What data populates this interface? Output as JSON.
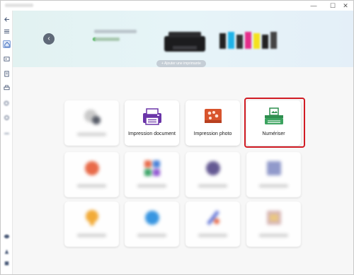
{
  "window": {
    "controls": {
      "minimize": "—",
      "maximize": "☐",
      "close": "✕"
    }
  },
  "sidebar": {
    "items": [
      {
        "icon": "back-arrow-icon"
      },
      {
        "icon": "menu-icon"
      },
      {
        "icon": "home-icon",
        "active": true
      },
      {
        "icon": "photo-icon"
      },
      {
        "icon": "document-icon"
      },
      {
        "icon": "printer-icon"
      },
      {
        "icon": "search-icon"
      },
      {
        "icon": "gear-icon"
      },
      {
        "icon": "cloud-icon"
      },
      {
        "icon": "user-icon"
      },
      {
        "icon": "help-icon"
      }
    ]
  },
  "banner": {
    "back_icon": "chevron-left-icon",
    "add_printer_label": "+ Ajouter une imprimante"
  },
  "tiles": {
    "impression_document": "Impression document",
    "impression_photo": "Impression photo",
    "numeriser": "Numériser"
  },
  "colors": {
    "highlight": "#d11c24",
    "document_icon": "#6a35a8",
    "photo_icon": "#d8542d",
    "scan_icon": "#2f8f4f",
    "back_button": "#5f6978"
  }
}
